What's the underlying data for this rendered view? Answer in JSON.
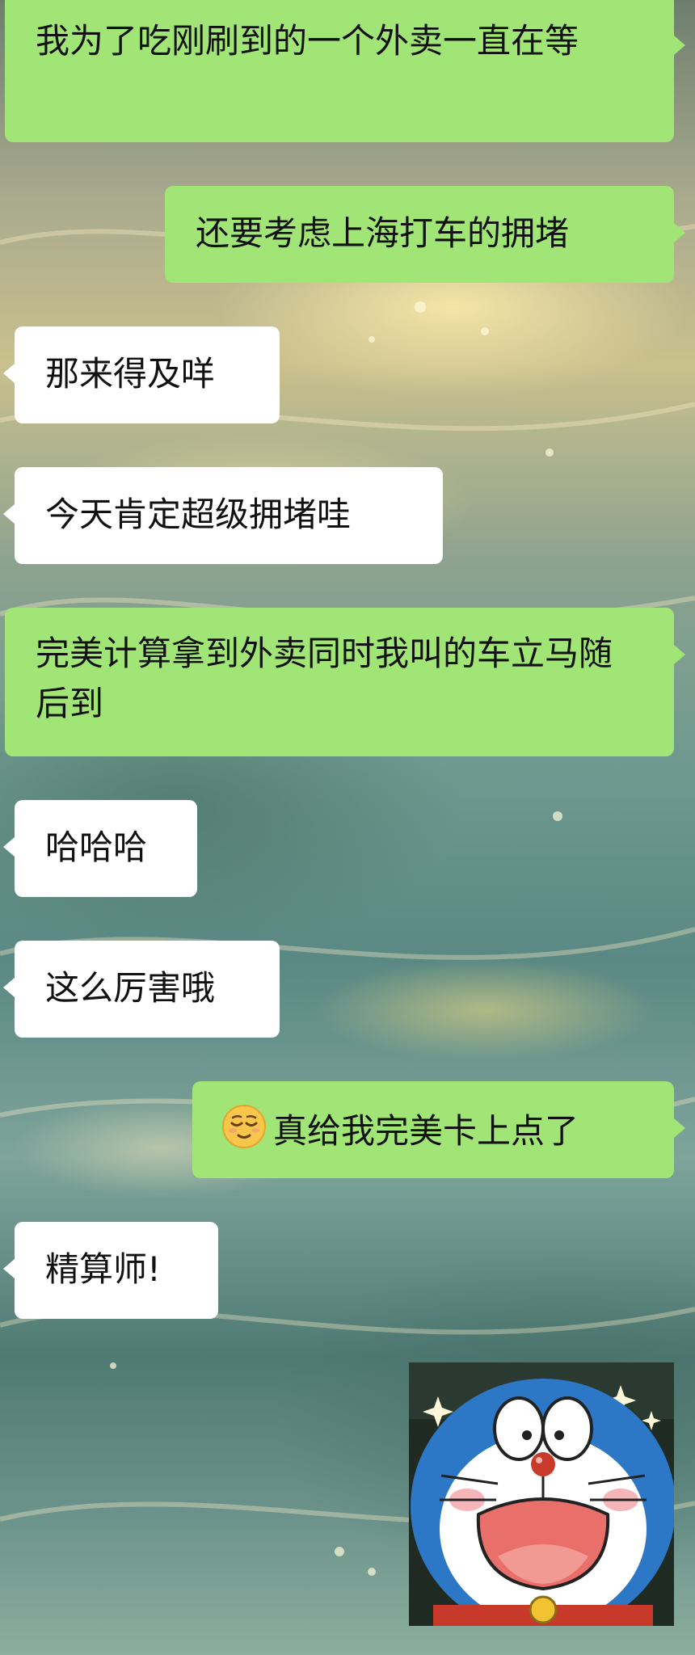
{
  "messages": [
    {
      "side": "me",
      "text": "我为了吃刚刷到的一个外卖一直在等"
    },
    {
      "side": "me",
      "text": "还要考虑上海打车的拥堵"
    },
    {
      "side": "them",
      "text": "那来得及咩"
    },
    {
      "side": "them",
      "text": "今天肯定超级拥堵哇"
    },
    {
      "side": "me",
      "text": "完美计算拿到外卖同时我叫的车立马随后到"
    },
    {
      "side": "them",
      "text": "哈哈哈"
    },
    {
      "side": "them",
      "text": "这么厉害哦"
    },
    {
      "side": "me",
      "emoji": "relieved-face-icon",
      "text": "真给我完美卡上点了"
    },
    {
      "side": "them",
      "text": "精算师!"
    },
    {
      "side": "me",
      "sticker": "doraemon-sticker"
    }
  ],
  "colors": {
    "my_bubble": "#a0e576",
    "their_bubble": "#ffffff"
  }
}
